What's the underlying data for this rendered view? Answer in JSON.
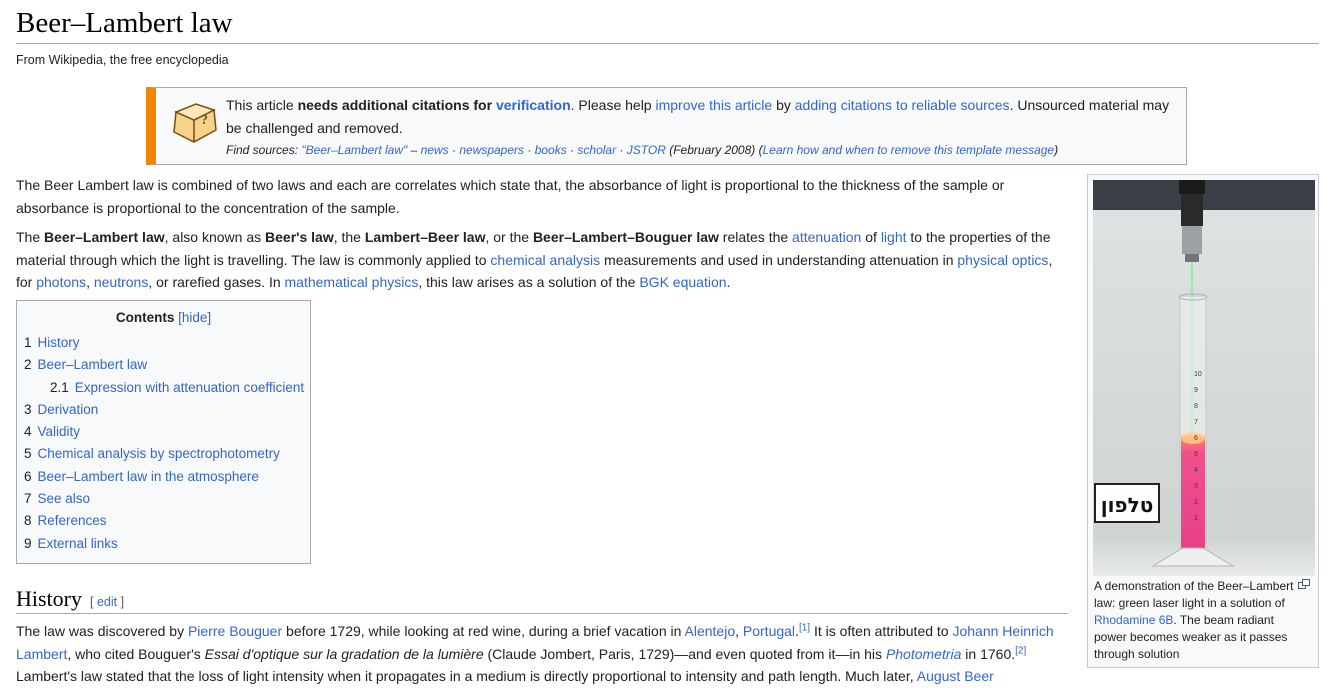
{
  "article": {
    "title": "Beer–Lambert law",
    "tagline": "From Wikipedia, the free encyclopedia"
  },
  "ambox": {
    "t1": "This article ",
    "t2": "needs additional citations for ",
    "t3": "verification",
    "t4": ". Please help ",
    "t5": "improve this article",
    "t6": " by ",
    "t7": "adding citations to reliable sources",
    "t8": ". Unsourced material may be challenged and removed.",
    "find_label": "Find sources: ",
    "find_query": "\"Beer–Lambert law\"",
    "dash": " – ",
    "news": "news",
    "newspapers": "newspapers",
    "books": "books",
    "scholar": "scholar",
    "jstor": "JSTOR",
    "sep": " · ",
    "date": " (February 2008) (",
    "learn": "Learn how and when to remove this template message",
    "close": ")"
  },
  "p1": "The Beer Lambert law is combined of two laws and each are correlates which state that, the absorbance of light is proportional to the thickness of the sample or absorbance is proportional to the concentration of the sample.",
  "p2": {
    "a": "The ",
    "b": "Beer–Lambert law",
    "c": ", also known as ",
    "d": "Beer's law",
    "e": ", the ",
    "f": "Lambert–Beer law",
    "g": ", or the ",
    "h": "Beer–Lambert–Bouguer law",
    "i": " relates the ",
    "j": "attenuation",
    "k": " of ",
    "l": "light",
    "m": " to the properties of the material through which the light is travelling. The law is commonly applied to ",
    "n": "chemical analysis",
    "o": " measurements and used in understanding attenuation in ",
    "p": "physical optics",
    "q": ", for ",
    "r": "photons",
    "s": ", ",
    "t": "neutrons",
    "u": ", or rarefied gases. In ",
    "v": "mathematical physics",
    "w": ", this law arises as a solution of the ",
    "x": "BGK equation",
    "y": "."
  },
  "toc": {
    "title": "Contents",
    "toggle": "[hide]",
    "items": [
      {
        "num": "1",
        "label": "History"
      },
      {
        "num": "2",
        "label": "Beer–Lambert law"
      },
      {
        "num": "2.1",
        "label": "Expression with attenuation coefficient"
      },
      {
        "num": "3",
        "label": "Derivation"
      },
      {
        "num": "4",
        "label": "Validity"
      },
      {
        "num": "5",
        "label": "Chemical analysis by spectrophotometry"
      },
      {
        "num": "6",
        "label": "Beer–Lambert law in the atmosphere"
      },
      {
        "num": "7",
        "label": "See also"
      },
      {
        "num": "8",
        "label": "References"
      },
      {
        "num": "9",
        "label": "External links"
      }
    ]
  },
  "history": {
    "heading": "History",
    "edit_open": "[ ",
    "edit": "edit",
    "edit_close": " ]",
    "a": "The law was discovered by ",
    "b": "Pierre Bouguer",
    "c": " before 1729, while looking at red wine, during a brief vacation in ",
    "d": "Alentejo",
    "e": ", ",
    "f": "Portugal",
    "g": ".",
    "ref1": "[1]",
    "h": " It is often attributed to ",
    "i": "Johann Heinrich Lambert",
    "j": ", who cited Bouguer's ",
    "k": "Essai d'optique sur la gradation de la lumière",
    "l": " (Claude Jombert, Paris, 1729)—and even quoted from it—in his ",
    "m": "Photometria",
    "n": " in 1760.",
    "ref2": "[2]",
    "p4a": "Lambert's law stated that the loss of light intensity when it propagates in a medium is directly proportional to intensity and path length. Much later, ",
    "p4b": "August Beer"
  },
  "thumb": {
    "c1": "A demonstration of the Beer–Lambert law: green laser light in a solution of ",
    "c2": "Rhodamine 6B",
    "c3": ". The beam radiant power becomes weaker as it passes through solution",
    "sign": "טלפון",
    "scale": [
      "10",
      "9",
      "8",
      "7",
      "6",
      "5",
      "4",
      "3",
      "2",
      "1"
    ]
  },
  "icons": {
    "notice": "book-question-icon",
    "magnify": "magnify-icon"
  },
  "colors": {
    "link": "#3366cc",
    "notice_bar": "#f28500",
    "liquid": "#f0508c",
    "laser": "#44ff66"
  }
}
